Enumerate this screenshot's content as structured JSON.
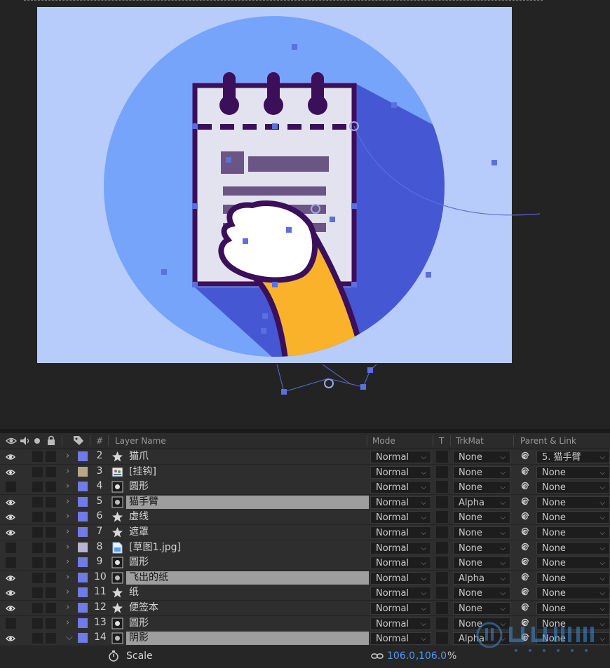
{
  "timeline": {
    "columns": {
      "number": "#",
      "layer_name": "Layer Name",
      "mode": "Mode",
      "t": "T",
      "trkmat": "TrkMat",
      "parent": "Parent & Link"
    },
    "layers": [
      {
        "num": "2",
        "name": "猫爪",
        "type": "star",
        "label_color": "#6f7be6",
        "mode": "Normal",
        "trkmat": "None",
        "parent": "5. 猫手臂",
        "visible": true,
        "selected": false
      },
      {
        "num": "3",
        "name": "[挂钩]",
        "type": "image",
        "label_color": "#b8a684",
        "mode": "Normal",
        "trkmat": "None",
        "parent": "None",
        "visible": true,
        "selected": false
      },
      {
        "num": "4",
        "name": "圆形",
        "type": "shape",
        "label_color": "#6f7be6",
        "mode": "Normal",
        "trkmat": "None",
        "parent": "None",
        "visible": false,
        "selected": false
      },
      {
        "num": "5",
        "name": "猫手臂",
        "type": "shape",
        "label_color": "#6f7be6",
        "mode": "Normal",
        "trkmat": "Alpha",
        "parent": "None",
        "visible": true,
        "selected": true
      },
      {
        "num": "6",
        "name": "虚线",
        "type": "star",
        "label_color": "#6f7be6",
        "mode": "Normal",
        "trkmat": "None",
        "parent": "None",
        "visible": true,
        "selected": false
      },
      {
        "num": "7",
        "name": "遮罩",
        "type": "star",
        "label_color": "#6f7be6",
        "mode": "Normal",
        "trkmat": "None",
        "parent": "None",
        "visible": true,
        "selected": false
      },
      {
        "num": "8",
        "name": "[草图1.jpg]",
        "type": "file",
        "label_color": "#b7b4d2",
        "mode": "Normal",
        "trkmat": "None",
        "parent": "None",
        "visible": false,
        "selected": false
      },
      {
        "num": "9",
        "name": "圆形",
        "type": "shape",
        "label_color": "#6f7be6",
        "mode": "Normal",
        "trkmat": "None",
        "parent": "None",
        "visible": false,
        "selected": false
      },
      {
        "num": "10",
        "name": "飞出的纸",
        "type": "shape",
        "label_color": "#6f7be6",
        "mode": "Normal",
        "trkmat": "Alpha",
        "parent": "None",
        "visible": true,
        "selected": true
      },
      {
        "num": "11",
        "name": "纸",
        "type": "star",
        "label_color": "#6f7be6",
        "mode": "Normal",
        "trkmat": "None",
        "parent": "None",
        "visible": true,
        "selected": false
      },
      {
        "num": "12",
        "name": "便签本",
        "type": "star",
        "label_color": "#6f7be6",
        "mode": "Normal",
        "trkmat": "None",
        "parent": "None",
        "visible": true,
        "selected": false
      },
      {
        "num": "13",
        "name": "圆形",
        "type": "shape",
        "label_color": "#6f7be6",
        "mode": "Normal",
        "trkmat": "None",
        "parent": "None",
        "visible": false,
        "selected": false
      },
      {
        "num": "14",
        "name": "阴影",
        "type": "shape",
        "label_color": "#6f7be6",
        "mode": "Normal",
        "trkmat": "Alpha",
        "parent": "None",
        "visible": true,
        "selected": true,
        "expanded": true
      }
    ],
    "property": {
      "name": "Scale",
      "value_x": "106.0",
      "value_sep": ",",
      "value_y": "106.0",
      "unit": "%"
    }
  },
  "colors": {
    "panel_bg": "#262626",
    "row_bg": "#2e2e2e",
    "selected_name_bg": "#9e9e9e",
    "value_blue": "#4a9bff",
    "canvas_bg": "#b8ccfb",
    "circle": "#75a4fa",
    "shadow": "#4657d3",
    "notepad_outline": "#3b0f5a",
    "notepad_paper": "#e2e3ee",
    "arm": "#f9b22a",
    "handle": "#5b6fe0"
  },
  "icons": [
    "eye-icon",
    "audio-icon",
    "solo-icon",
    "lock-icon",
    "label-tag-icon",
    "star-icon",
    "shape-icon",
    "image-icon",
    "file-icon",
    "chevron-right-icon",
    "chevron-down-icon",
    "spiral-pickwhip-icon",
    "stopwatch-icon",
    "link-icon"
  ]
}
